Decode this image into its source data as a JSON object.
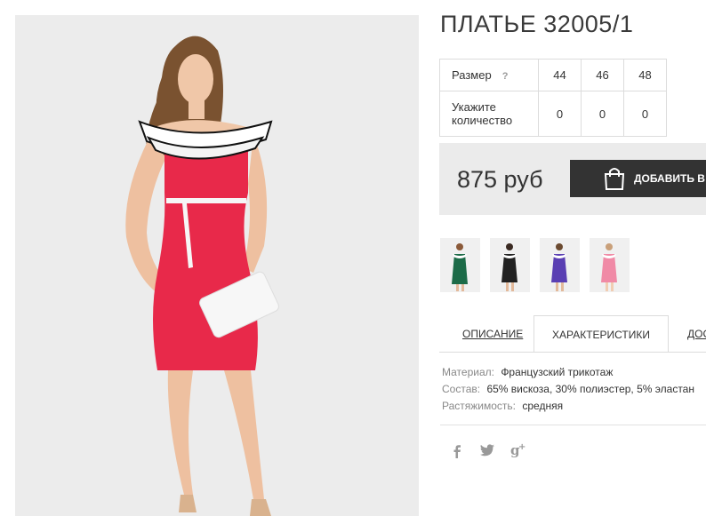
{
  "product": {
    "title": "ПЛАТЬЕ 32005/1",
    "size_label": "Размер",
    "size_help": "?",
    "sizes": [
      "44",
      "46",
      "48"
    ],
    "qty_label": "Укажите количество",
    "quantities": [
      "0",
      "0",
      "0"
    ],
    "price": "875 руб",
    "add_to_cart": "ДОБАВИТЬ В КОРЗИНУ",
    "bag_icon": "shopping-bag-icon",
    "thumbnails": [
      {
        "name": "green",
        "color": "#1c6b48"
      },
      {
        "name": "black",
        "color": "#222222"
      },
      {
        "name": "purple",
        "color": "#5a3fb3"
      },
      {
        "name": "pink",
        "color": "#f08aa6"
      }
    ],
    "main_dress_color": "#e8294a"
  },
  "tabs": [
    {
      "label": "ОПИСАНИЕ"
    },
    {
      "label": "ХАРАКТЕРИСТИКИ",
      "active": true
    },
    {
      "label": "ДОСТАВКА"
    }
  ],
  "characteristics": [
    {
      "key": "Материал:",
      "value": "Французский трикотаж"
    },
    {
      "key": "Состав:",
      "value": "65% вискоза, 30% полиэстер, 5% эластан"
    },
    {
      "key": "Растяжимость:",
      "value": "средняя"
    }
  ],
  "social": [
    {
      "icon": "facebook-icon",
      "glyph": "f"
    },
    {
      "icon": "twitter-icon",
      "glyph": "t"
    },
    {
      "icon": "google-plus-icon",
      "glyph": "g+"
    }
  ]
}
